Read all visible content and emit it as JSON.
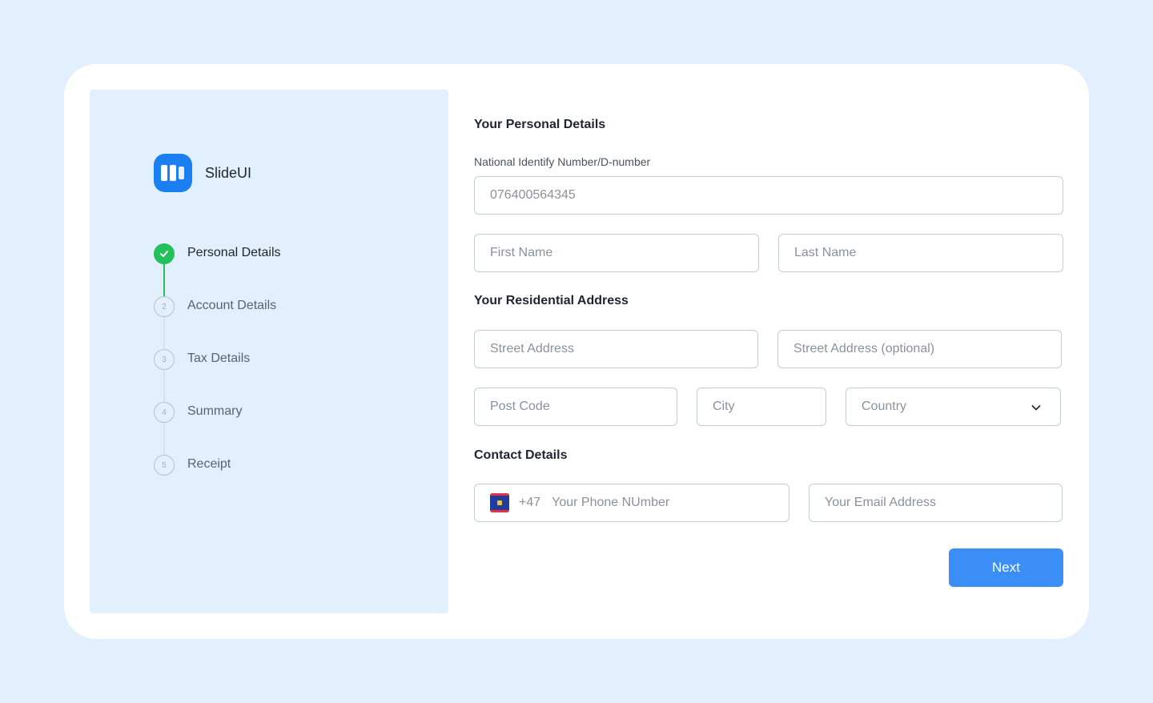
{
  "brand": {
    "name": "SlideUI",
    "logo_icon": "book-icon",
    "logo_color": "#1a7ff0"
  },
  "steps": [
    {
      "number": "1",
      "label": "Personal Details",
      "status": "completed"
    },
    {
      "number": "2",
      "label": "Account Details",
      "status": "pending"
    },
    {
      "number": "3",
      "label": "Tax Details",
      "status": "pending"
    },
    {
      "number": "4",
      "label": "Summary",
      "status": "pending"
    },
    {
      "number": "5",
      "label": "Receipt",
      "status": "pending"
    }
  ],
  "personal": {
    "title": "Your Personal Details",
    "national_id_label": "National Identify Number/D-number",
    "national_id_value": "076400564345",
    "first_name_placeholder": "First Name",
    "last_name_placeholder": "Last Name"
  },
  "address": {
    "title": "Your Residential Address",
    "street_placeholder": "Street Address",
    "street2_placeholder": "Street Address (optional)",
    "postcode_placeholder": "Post Code",
    "city_placeholder": "City",
    "country_placeholder": "Country"
  },
  "contact": {
    "title": "Contact Details",
    "phone_code": "+47",
    "phone_placeholder": "Your Phone NUmber",
    "email_placeholder": "Your Email Address"
  },
  "actions": {
    "next_label": "Next"
  },
  "colors": {
    "accent": "#3a8ef6",
    "success": "#24c05a",
    "background": "#e2f0fd"
  }
}
